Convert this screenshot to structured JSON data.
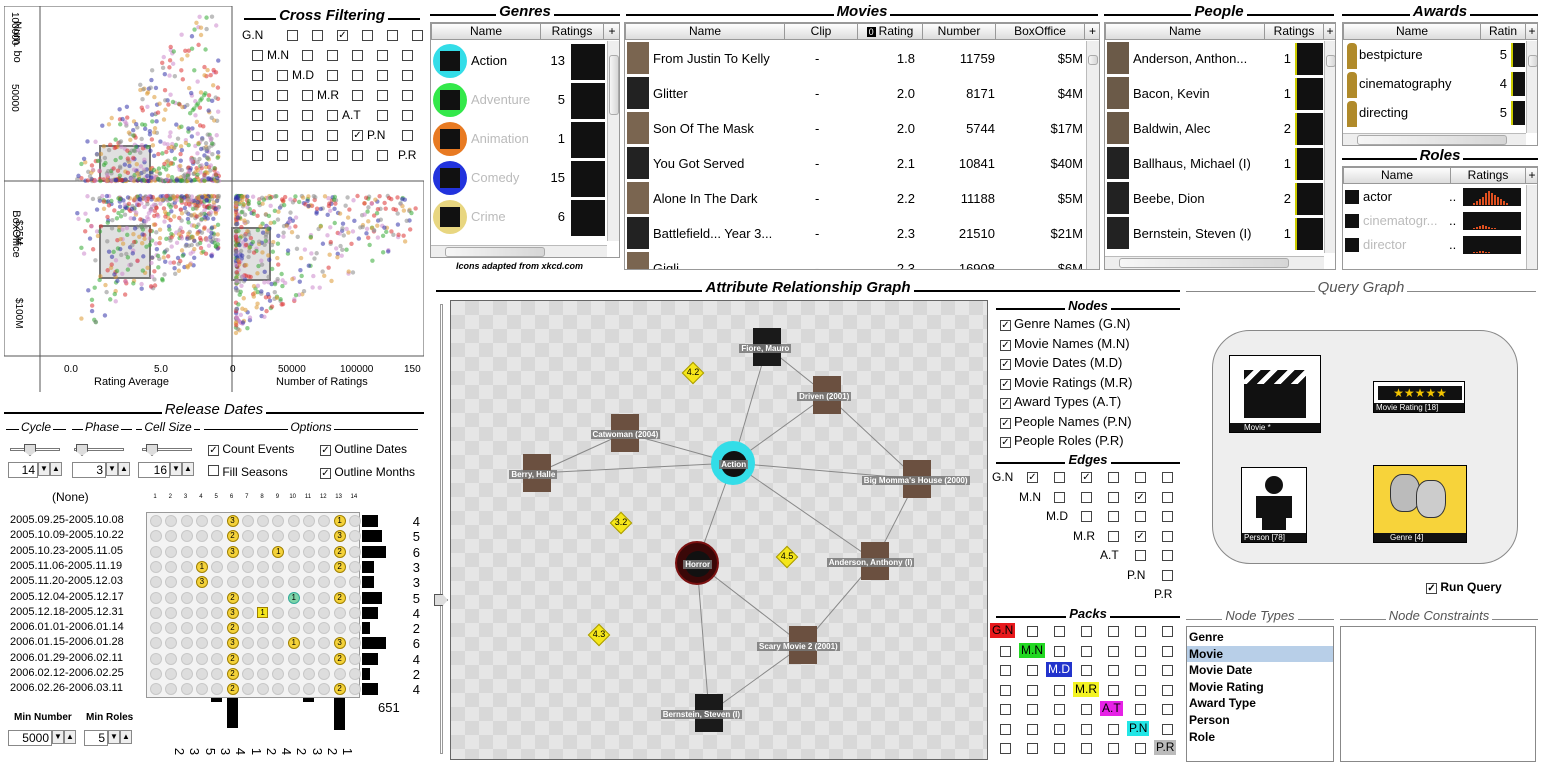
{
  "scatter": {
    "y_top_ticks": [
      "100000",
      "50000"
    ],
    "y_top_label": "Num. bo",
    "y_bot_ticks": [
      "$25M",
      "$100M"
    ],
    "y_bot_label": "BoxOffice",
    "x_left_ticks": [
      "0.0",
      "5.0"
    ],
    "x_left_label": "Rating Average",
    "x_right_ticks": [
      "0",
      "50000",
      "100000",
      "150"
    ],
    "x_right_label": "Number of Ratings"
  },
  "cross_filter": {
    "title": "Cross Filtering",
    "labels": [
      "G.N",
      "M.N",
      "M.D",
      "M.R",
      "A.T",
      "P.N",
      "P.R"
    ]
  },
  "genres": {
    "title": "Genres",
    "col_name": "Name",
    "col_ratings": "Ratings",
    "plus": "+",
    "rows": [
      {
        "name": "Action",
        "count": "13",
        "color": "#33dde8",
        "dim": false
      },
      {
        "name": "Adventure",
        "count": "5",
        "color": "#33e84a",
        "dim": true
      },
      {
        "name": "Animation",
        "count": "1",
        "color": "#e87a22",
        "dim": true
      },
      {
        "name": "Comedy",
        "count": "15",
        "color": "#2233dd",
        "dim": true
      },
      {
        "name": "Crime",
        "count": "6",
        "color": "#e8d680",
        "dim": true
      }
    ],
    "footer": "Icons adapted from xkcd.com"
  },
  "movies": {
    "title": "Movies",
    "cols": [
      "Name",
      "Clip",
      "Rating",
      "Number",
      "BoxOffice"
    ],
    "sort_badge": "0",
    "plus": "+",
    "rows": [
      {
        "name": "From Justin To Kelly",
        "clip": "-",
        "rating": "1.8",
        "number": "11759",
        "box": "$5M"
      },
      {
        "name": "Glitter",
        "clip": "-",
        "rating": "2.0",
        "number": "8171",
        "box": "$4M"
      },
      {
        "name": "Son Of The Mask",
        "clip": "-",
        "rating": "2.0",
        "number": "5744",
        "box": "$17M"
      },
      {
        "name": "You Got Served",
        "clip": "-",
        "rating": "2.1",
        "number": "10841",
        "box": "$40M"
      },
      {
        "name": "Alone In The Dark",
        "clip": "-",
        "rating": "2.2",
        "number": "11188",
        "box": "$5M"
      },
      {
        "name": "Battlefield... Year 3...",
        "clip": "-",
        "rating": "2.3",
        "number": "21510",
        "box": "$21M"
      },
      {
        "name": "Gigli",
        "clip": "-",
        "rating": "2.3",
        "number": "16908",
        "box": "$6M"
      }
    ]
  },
  "people": {
    "title": "People",
    "col_name": "Name",
    "col_ratings": "Ratings",
    "plus": "+",
    "rows": [
      {
        "name": "Anderson, Anthon...",
        "count": "1"
      },
      {
        "name": "Bacon, Kevin",
        "count": "1"
      },
      {
        "name": "Baldwin, Alec",
        "count": "2"
      },
      {
        "name": "Ballhaus, Michael (I)",
        "count": "1"
      },
      {
        "name": "Beebe, Dion",
        "count": "2"
      },
      {
        "name": "Bernstein, Steven (I)",
        "count": "1"
      }
    ]
  },
  "awards": {
    "title": "Awards",
    "col_name": "Name",
    "col_ratings": "Ratin",
    "plus": "+",
    "rows": [
      {
        "name": "bestpicture",
        "count": "5"
      },
      {
        "name": "cinematography",
        "count": "4"
      },
      {
        "name": "directing",
        "count": "5"
      }
    ]
  },
  "roles": {
    "title": "Roles",
    "col_name": "Name",
    "col_ratings": "Ratings",
    "plus": "+",
    "rows": [
      {
        "name": "actor",
        "count": "..",
        "dim": false
      },
      {
        "name": "cinematogr...",
        "count": "..",
        "dim": true
      },
      {
        "name": "director",
        "count": "..",
        "dim": true
      }
    ]
  },
  "release": {
    "title": "Release Dates",
    "cycle": "Cycle",
    "phase": "Phase",
    "cell_size": "Cell Size",
    "options": "Options",
    "cycle_val": "14",
    "phase_val": "3",
    "cell_val": "16",
    "count_events": "Count Events",
    "fill_seasons": "Fill Seasons",
    "outline_dates": "Outline Dates",
    "outline_months": "Outline Months",
    "none_label": "(None)",
    "col_nums": [
      "1",
      "2",
      "3",
      "4",
      "5",
      "6",
      "7",
      "8",
      "9",
      "10",
      "11",
      "12",
      "13",
      "14"
    ],
    "rows": [
      {
        "label": "2005.09.25-2005.10.08",
        "count": "4"
      },
      {
        "label": "2005.10.09-2005.10.22",
        "count": "5"
      },
      {
        "label": "2005.10.23-2005.11.05",
        "count": "6"
      },
      {
        "label": "2005.11.06-2005.11.19",
        "count": "3"
      },
      {
        "label": "2005.11.20-2005.12.03",
        "count": "3"
      },
      {
        "label": "2005.12.04-2005.12.17",
        "count": "5"
      },
      {
        "label": "2005.12.18-2005.12.31",
        "count": "4"
      },
      {
        "label": "2006.01.01-2006.01.14",
        "count": "2"
      },
      {
        "label": "2006.01.15-2006.01.28",
        "count": "6"
      },
      {
        "label": "2006.01.29-2006.02.11",
        "count": "4"
      },
      {
        "label": "2006.02.12-2006.02.25",
        "count": "2"
      },
      {
        "label": "2006.02.26-2006.03.11",
        "count": "4"
      }
    ],
    "total": "651",
    "min_number": "Min Number",
    "min_roles": "Min Roles",
    "min_number_val": "5000",
    "min_roles_val": "5",
    "col_totals": [
      "2",
      "3",
      "5",
      "3",
      "4",
      "1",
      "2",
      "4",
      "2",
      "3",
      "2",
      "1"
    ]
  },
  "graph": {
    "title": "Attribute Relationship Graph",
    "nodes": [
      {
        "label": "Fiore, Mauro"
      },
      {
        "label": "Driven (2001)"
      },
      {
        "label": "Catwoman (2004)"
      },
      {
        "label": "Action"
      },
      {
        "label": "Berry, Halle"
      },
      {
        "label": "Big Momma's House (2000)"
      },
      {
        "label": "Horror"
      },
      {
        "label": "Anderson, Anthony (I)"
      },
      {
        "label": "Scary Movie 2 (2001)"
      },
      {
        "label": "Bernstein, Steven (I)"
      }
    ],
    "ratings": [
      "4.2",
      "3.2",
      "4.5",
      "4.3"
    ]
  },
  "nodes_panel": {
    "title": "Nodes",
    "items": [
      "Genre Names (G.N)",
      "Movie Names (M.N)",
      "Movie Dates (M.D)",
      "Movie Ratings (M.R)",
      "Award Types (A.T)",
      "People Names (P.N)",
      "People Roles (P.R)"
    ]
  },
  "edges_panel": {
    "title": "Edges",
    "labels": [
      "G.N",
      "M.N",
      "M.D",
      "M.R",
      "A.T",
      "P.N",
      "P.R"
    ]
  },
  "packs_panel": {
    "title": "Packs",
    "labels": [
      {
        "t": "G.N",
        "c": "#e8191c"
      },
      {
        "t": "M.N",
        "c": "#22d822"
      },
      {
        "t": "M.D",
        "c": "#2233cc"
      },
      {
        "t": "M.R",
        "c": "#f3f322"
      },
      {
        "t": "A.T",
        "c": "#e622e6"
      },
      {
        "t": "P.N",
        "c": "#22e6e6"
      },
      {
        "t": "P.R",
        "c": "#bbbbbb"
      }
    ]
  },
  "query": {
    "title": "Query Graph",
    "movie": "Movie *",
    "rating": "Movie Rating [18]",
    "stars": "★★★★★",
    "person": "Person [78]",
    "genre": "Genre [4]",
    "run": "Run Query"
  },
  "node_types": {
    "title": "Node Types",
    "items": [
      "Genre",
      "Movie",
      "Movie Date",
      "Movie Rating",
      "Award Type",
      "Person",
      "Role"
    ],
    "selected": 1
  },
  "constraints": {
    "title": "Node Constraints"
  }
}
